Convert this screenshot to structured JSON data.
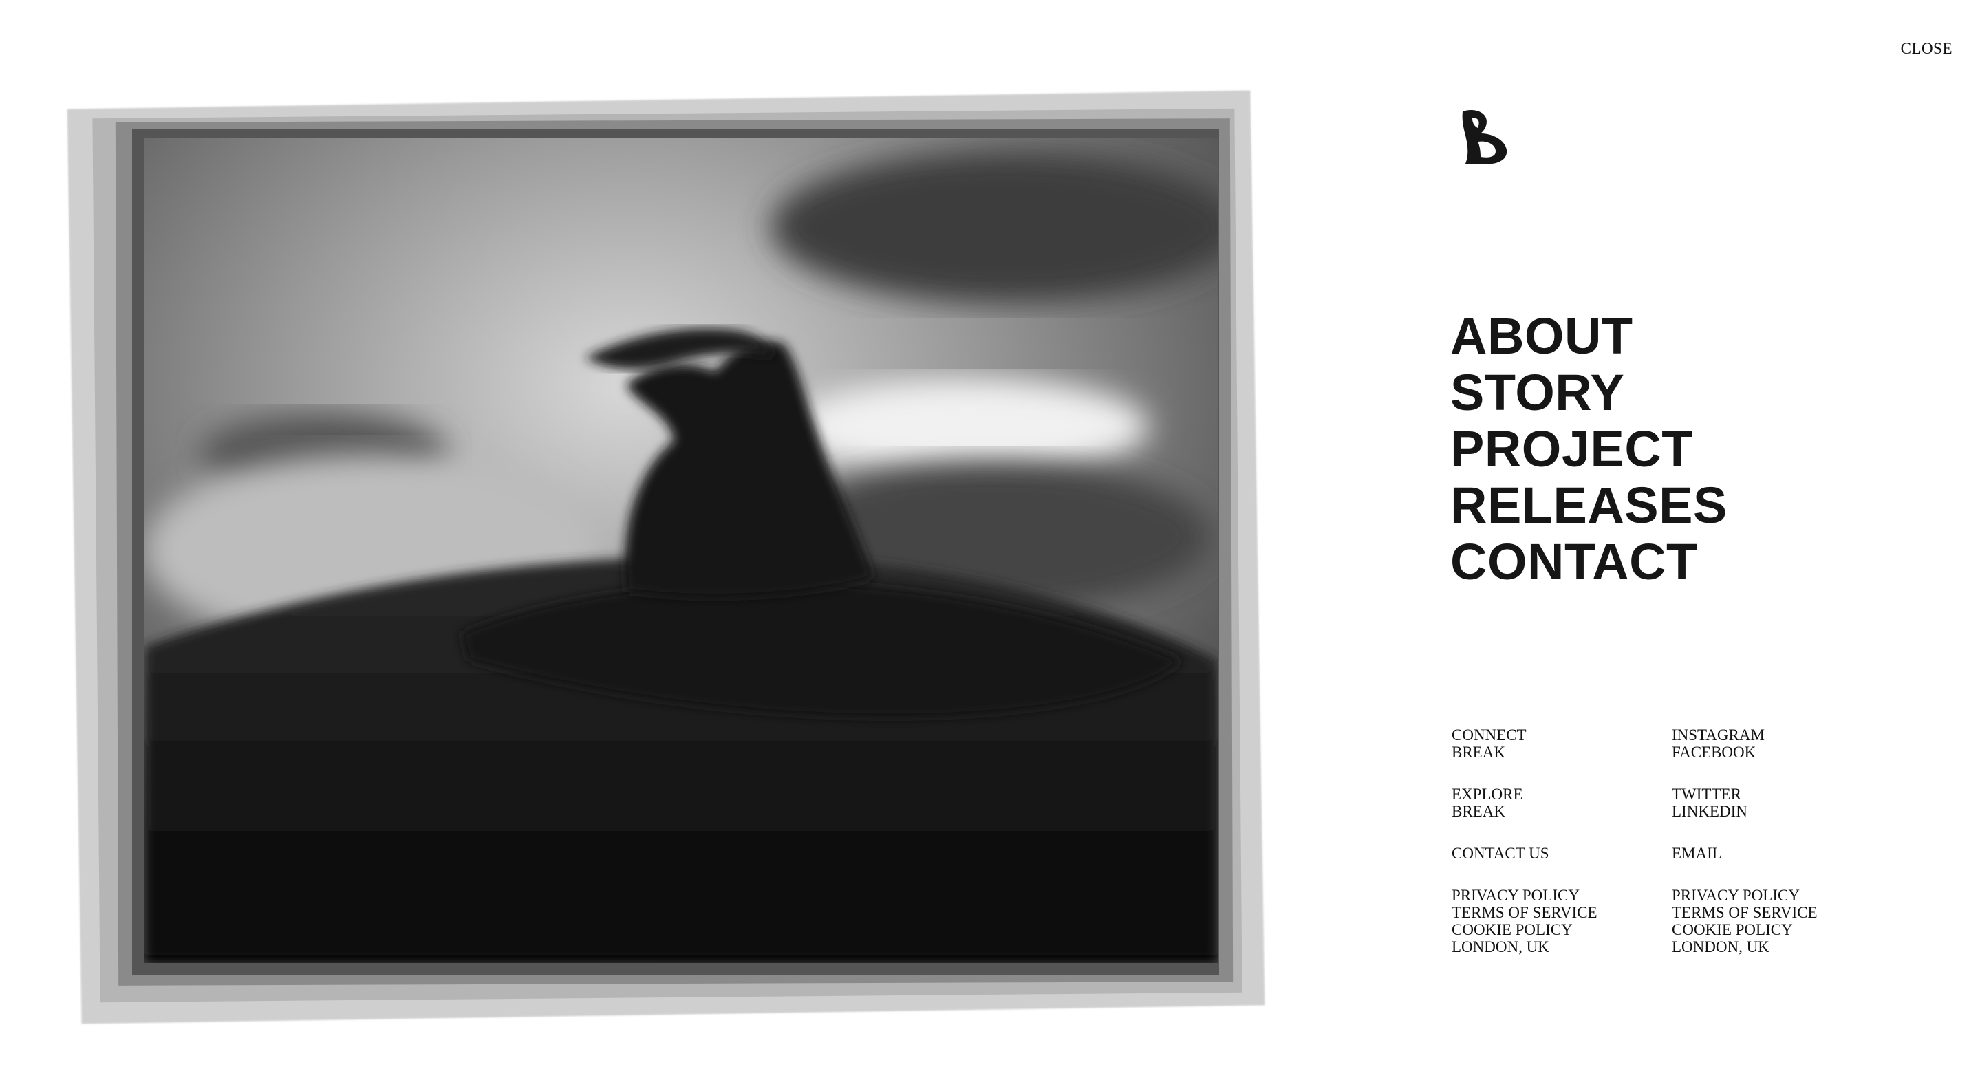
{
  "close_label": "CLOSE",
  "logo_letter": "B",
  "main_nav": [
    "ABOUT",
    "STORY",
    "PROJECT",
    "RELEASES",
    "CONTACT"
  ],
  "footer": {
    "left": [
      [
        "CONNECT",
        "BREAK"
      ],
      [
        "EXPLORE",
        "BREAK"
      ],
      [
        "CONTACT US"
      ],
      [
        "PRIVACY POLICY",
        "TERMS OF SERVICE",
        "COOKIE POLICY",
        "LONDON, UK"
      ]
    ],
    "right": [
      [
        "INSTAGRAM",
        "FACEBOOK"
      ],
      [
        "TWITTER",
        "LINKEDIN"
      ],
      [
        "EMAIL"
      ],
      [
        "PRIVACY POLICY",
        "TERMS OF SERVICE",
        "COOKIE POLICY",
        "LONDON, UK"
      ]
    ]
  },
  "photo": {
    "subject": "surfer-silhouette-icon"
  }
}
